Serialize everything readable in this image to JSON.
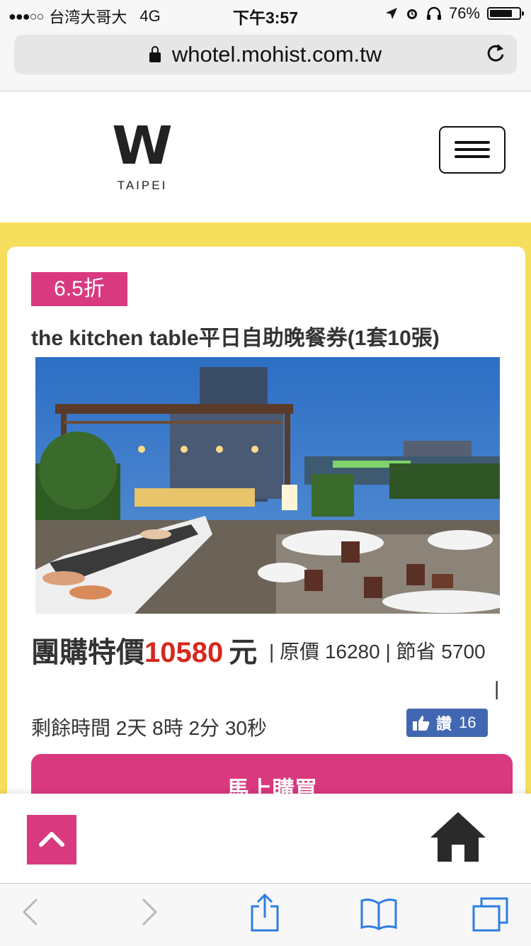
{
  "status_bar": {
    "carrier": "台湾大哥大",
    "network": "4G",
    "time": "下午3:57",
    "battery": "76%"
  },
  "browser": {
    "url": "whotel.mohist.com.tw"
  },
  "header": {
    "logo_letter": "W",
    "logo_sub": "TAIPEI"
  },
  "deal": {
    "discount_badge": "6.5折",
    "title": "the kitchen table平日自助晚餐券(1套10張)",
    "price_label": "團購特價",
    "price_value": "10580",
    "price_unit": "元",
    "price_meta": "| 原價 16280 | 節省 5700",
    "price_meta_tail": "|",
    "timer": "剩餘時間 2天 8時 2分 30秒",
    "like_label": "讚",
    "like_count": "16",
    "buy_label": "馬上購買"
  },
  "colors": {
    "accent": "#d9397f",
    "price": "#d7281e",
    "background": "#f6de5d",
    "facebook": "#4267b2"
  }
}
